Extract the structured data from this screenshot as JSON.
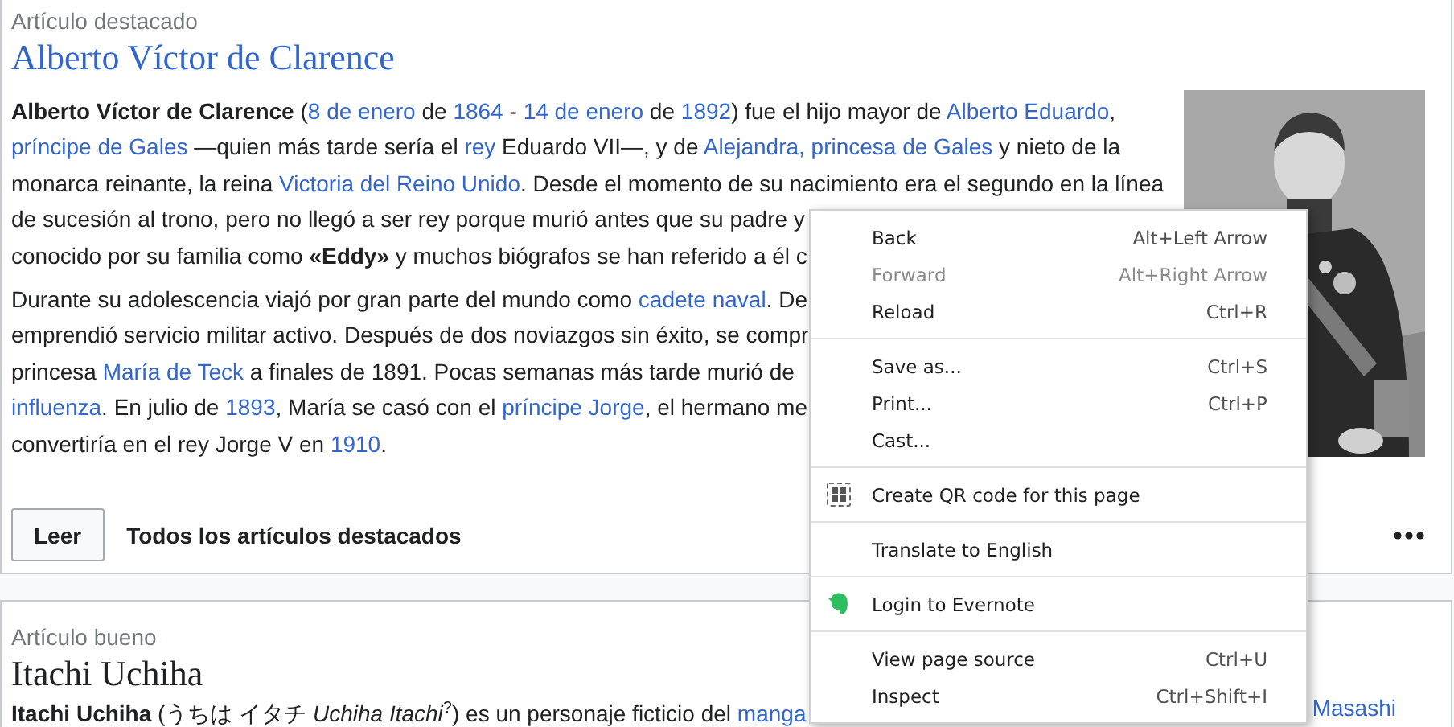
{
  "featured": {
    "label": "Artículo destacado",
    "title": "Alberto Víctor de Clarence",
    "paragraphs": [
      [
        [
          {
            "kind": "bold",
            "text": "Alberto Víctor de Clarence"
          },
          {
            "kind": "text",
            "text": " ("
          },
          {
            "kind": "link",
            "text": "8 de enero"
          },
          {
            "kind": "text",
            "text": " de "
          },
          {
            "kind": "link",
            "text": "1864"
          },
          {
            "kind": "text",
            "text": " - "
          },
          {
            "kind": "link",
            "text": "14 de enero"
          },
          {
            "kind": "text",
            "text": " de "
          },
          {
            "kind": "link",
            "text": "1892"
          },
          {
            "kind": "text",
            "text": ") fue el hijo mayor de "
          },
          {
            "kind": "link",
            "text": "Alberto Eduardo"
          },
          {
            "kind": "text",
            "text": ","
          }
        ],
        [
          {
            "kind": "link",
            "text": "príncipe de Gales"
          },
          {
            "kind": "text",
            "text": " —quien más tarde sería el "
          },
          {
            "kind": "link",
            "text": "rey"
          },
          {
            "kind": "text",
            "text": " Eduardo VII—, y de "
          },
          {
            "kind": "link",
            "text": "Alejandra, princesa de Gales"
          },
          {
            "kind": "text",
            "text": " y nieto de la"
          }
        ],
        [
          {
            "kind": "text",
            "text": "monarca reinante, la reina "
          },
          {
            "kind": "link",
            "text": "Victoria del Reino Unido"
          },
          {
            "kind": "text",
            "text": ". Desde el momento de su nacimiento era el segundo en la línea"
          }
        ],
        [
          {
            "kind": "text",
            "text": "de sucesión al trono, pero no llegó a ser rey porque murió antes que su padre y"
          }
        ],
        [
          {
            "kind": "text",
            "text": "conocido por su familia como "
          },
          {
            "kind": "bold",
            "text": "«Eddy»"
          },
          {
            "kind": "text",
            "text": " y muchos biógrafos se han referido a él c"
          }
        ]
      ],
      [
        [
          {
            "kind": "text",
            "text": "Durante su adolescencia viajó por gran parte del mundo como "
          },
          {
            "kind": "link",
            "text": "cadete naval"
          },
          {
            "kind": "text",
            "text": ". De"
          }
        ],
        [
          {
            "kind": "text",
            "text": "emprendió servicio militar activo. Después de dos noviazgos sin éxito, se compr"
          }
        ],
        [
          {
            "kind": "text",
            "text": "princesa "
          },
          {
            "kind": "link",
            "text": "María de Teck"
          },
          {
            "kind": "text",
            "text": " a finales de 1891. Pocas semanas más tarde murió de"
          }
        ],
        [
          {
            "kind": "link",
            "text": "influenza"
          },
          {
            "kind": "text",
            "text": ". En julio de "
          },
          {
            "kind": "link",
            "text": "1893"
          },
          {
            "kind": "text",
            "text": ", María se casó con el "
          },
          {
            "kind": "link",
            "text": "príncipe Jorge"
          },
          {
            "kind": "text",
            "text": ", el hermano me"
          }
        ],
        [
          {
            "kind": "text",
            "text": "convertiría en el rey Jorge V en "
          },
          {
            "kind": "link",
            "text": "1910"
          },
          {
            "kind": "text",
            "text": "."
          }
        ]
      ]
    ],
    "image": {
      "kind": "picture"
    },
    "read_button": "Leer",
    "all_link": "Todos los artículos destacados"
  },
  "good": {
    "label": "Artículo bueno",
    "title": "Itachi Uchiha",
    "line": [
      {
        "kind": "bold",
        "text": "Itachi Uchiha"
      },
      {
        "kind": "text",
        "text": " (うちは イタチ "
      },
      {
        "kind": "italic",
        "text": "Uchiha Itachi"
      },
      {
        "kind": "sup",
        "text": "?"
      },
      {
        "kind": "text",
        "text": ") es un personaje ficticio del "
      },
      {
        "kind": "link",
        "text": "manga"
      }
    ],
    "line_end": [
      {
        "kind": "link",
        "text": "Masashi"
      }
    ]
  },
  "context_menu": {
    "items": [
      {
        "kind": "command",
        "label": "Back",
        "shortcut": "Alt+Left Arrow",
        "disabled": false
      },
      {
        "kind": "command",
        "label": "Forward",
        "shortcut": "Alt+Right Arrow",
        "disabled": true
      },
      {
        "kind": "command",
        "label": "Reload",
        "shortcut": "Ctrl+R",
        "disabled": false
      },
      {
        "kind": "separator"
      },
      {
        "kind": "command",
        "label": "Save as...",
        "shortcut": "Ctrl+S",
        "disabled": false
      },
      {
        "kind": "command",
        "label": "Print...",
        "shortcut": "Ctrl+P",
        "disabled": false
      },
      {
        "kind": "command",
        "label": "Cast...",
        "disabled": false
      },
      {
        "kind": "separator"
      },
      {
        "kind": "qr-command",
        "label": "Create QR code for this page",
        "disabled": false
      },
      {
        "kind": "separator"
      },
      {
        "kind": "command",
        "label": "Translate to English",
        "disabled": false
      },
      {
        "kind": "separator"
      },
      {
        "kind": "evernote-command",
        "label": "Login to Evernote",
        "disabled": false
      },
      {
        "kind": "separator"
      },
      {
        "kind": "command",
        "label": "View page source",
        "shortcut": "Ctrl+U",
        "disabled": false
      },
      {
        "kind": "command",
        "label": "Inspect",
        "shortcut": "Ctrl+Shift+I",
        "disabled": false
      }
    ]
  }
}
